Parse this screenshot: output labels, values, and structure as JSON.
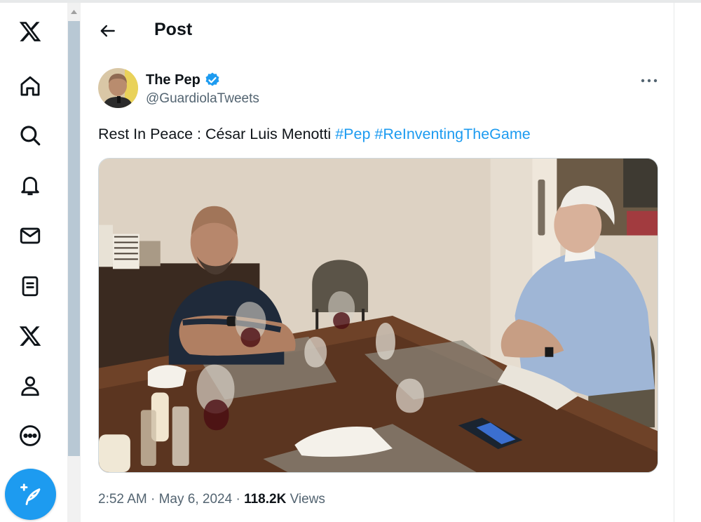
{
  "nav": {
    "items": [
      {
        "name": "x-logo-icon"
      },
      {
        "name": "home-icon"
      },
      {
        "name": "search-icon"
      },
      {
        "name": "notifications-icon"
      },
      {
        "name": "messages-icon"
      },
      {
        "name": "lists-icon"
      },
      {
        "name": "premium-x-icon"
      },
      {
        "name": "profile-icon"
      },
      {
        "name": "more-icon"
      }
    ],
    "compose_icon": "compose-post-icon"
  },
  "header": {
    "title": "Post"
  },
  "post": {
    "display_name": "The Pep",
    "handle": "@GuardiolaTweets",
    "text": "Rest In Peace : César Luis Menotti",
    "hashtags": [
      "#Pep",
      "#ReInventingTheGame"
    ],
    "time": "2:52 AM",
    "date": "May 6, 2024",
    "views_count": "118.2K",
    "views_label": "Views"
  },
  "colors": {
    "accent": "#1d9bf0",
    "text_primary": "#0f1419",
    "text_secondary": "#536471"
  }
}
